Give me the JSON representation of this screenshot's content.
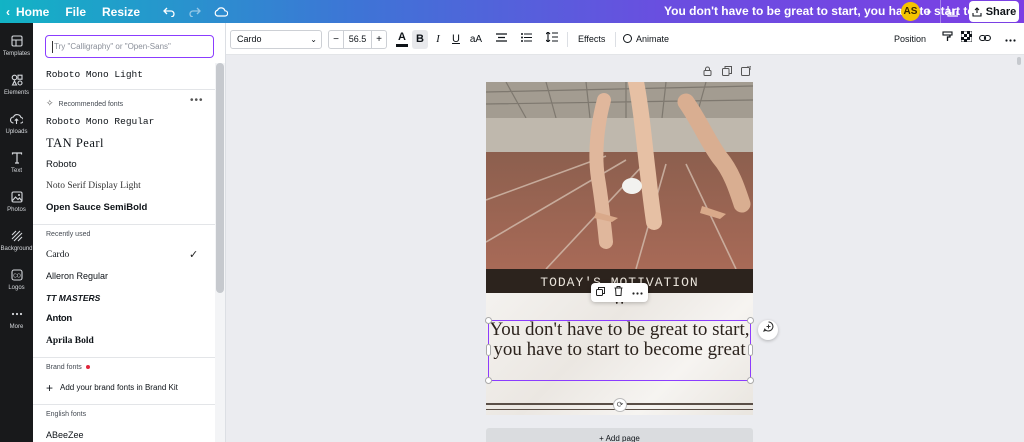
{
  "topbar": {
    "home": "Home",
    "file": "File",
    "resize": "Resize",
    "doc_title": "You don't have to be great to start, you have to start to bec...",
    "avatar_initials": "AS",
    "share": "Share"
  },
  "rail": [
    {
      "label": "Templates",
      "icon": "templates-icon"
    },
    {
      "label": "Elements",
      "icon": "elements-icon"
    },
    {
      "label": "Uploads",
      "icon": "uploads-icon"
    },
    {
      "label": "Text",
      "icon": "text-icon"
    },
    {
      "label": "Photos",
      "icon": "photos-icon"
    },
    {
      "label": "Background",
      "icon": "background-icon"
    },
    {
      "label": "Logos",
      "icon": "logos-icon"
    },
    {
      "label": "More",
      "icon": "more-icon"
    }
  ],
  "panel": {
    "search_placeholder": "Try \"Calligraphy\" or \"Open-Sans\"",
    "top_font": "Roboto Mono Light",
    "recommended_label": "Recommended fonts",
    "recommended": [
      "Roboto Mono Regular",
      "TAN Pearl",
      "Roboto",
      "Noto Serif Display Light",
      "Open Sauce SemiBold"
    ],
    "recent_label": "Recently used",
    "recent": [
      "Cardo",
      "Alleron Regular",
      "TT MASTERS",
      "Anton",
      "Aprila Bold"
    ],
    "brand_label": "Brand fonts",
    "add_brand": "Add your brand fonts in Brand Kit",
    "english_label": "English fonts",
    "english": [
      "ABeeZee"
    ]
  },
  "toolbar": {
    "font": "Cardo",
    "size": "56.5",
    "minus": "−",
    "plus": "+",
    "text_color_label": "A",
    "bold": "B",
    "italic": "I",
    "underline": "U",
    "case": "aA",
    "effects": "Effects",
    "animate": "Animate",
    "position": "Position"
  },
  "design": {
    "motivation": "TODAY'S MOTIVATION",
    "quote_mark": "\"",
    "quote": "You don't have to be great to start, you have to start to become great"
  },
  "add_page": "+ Add page"
}
